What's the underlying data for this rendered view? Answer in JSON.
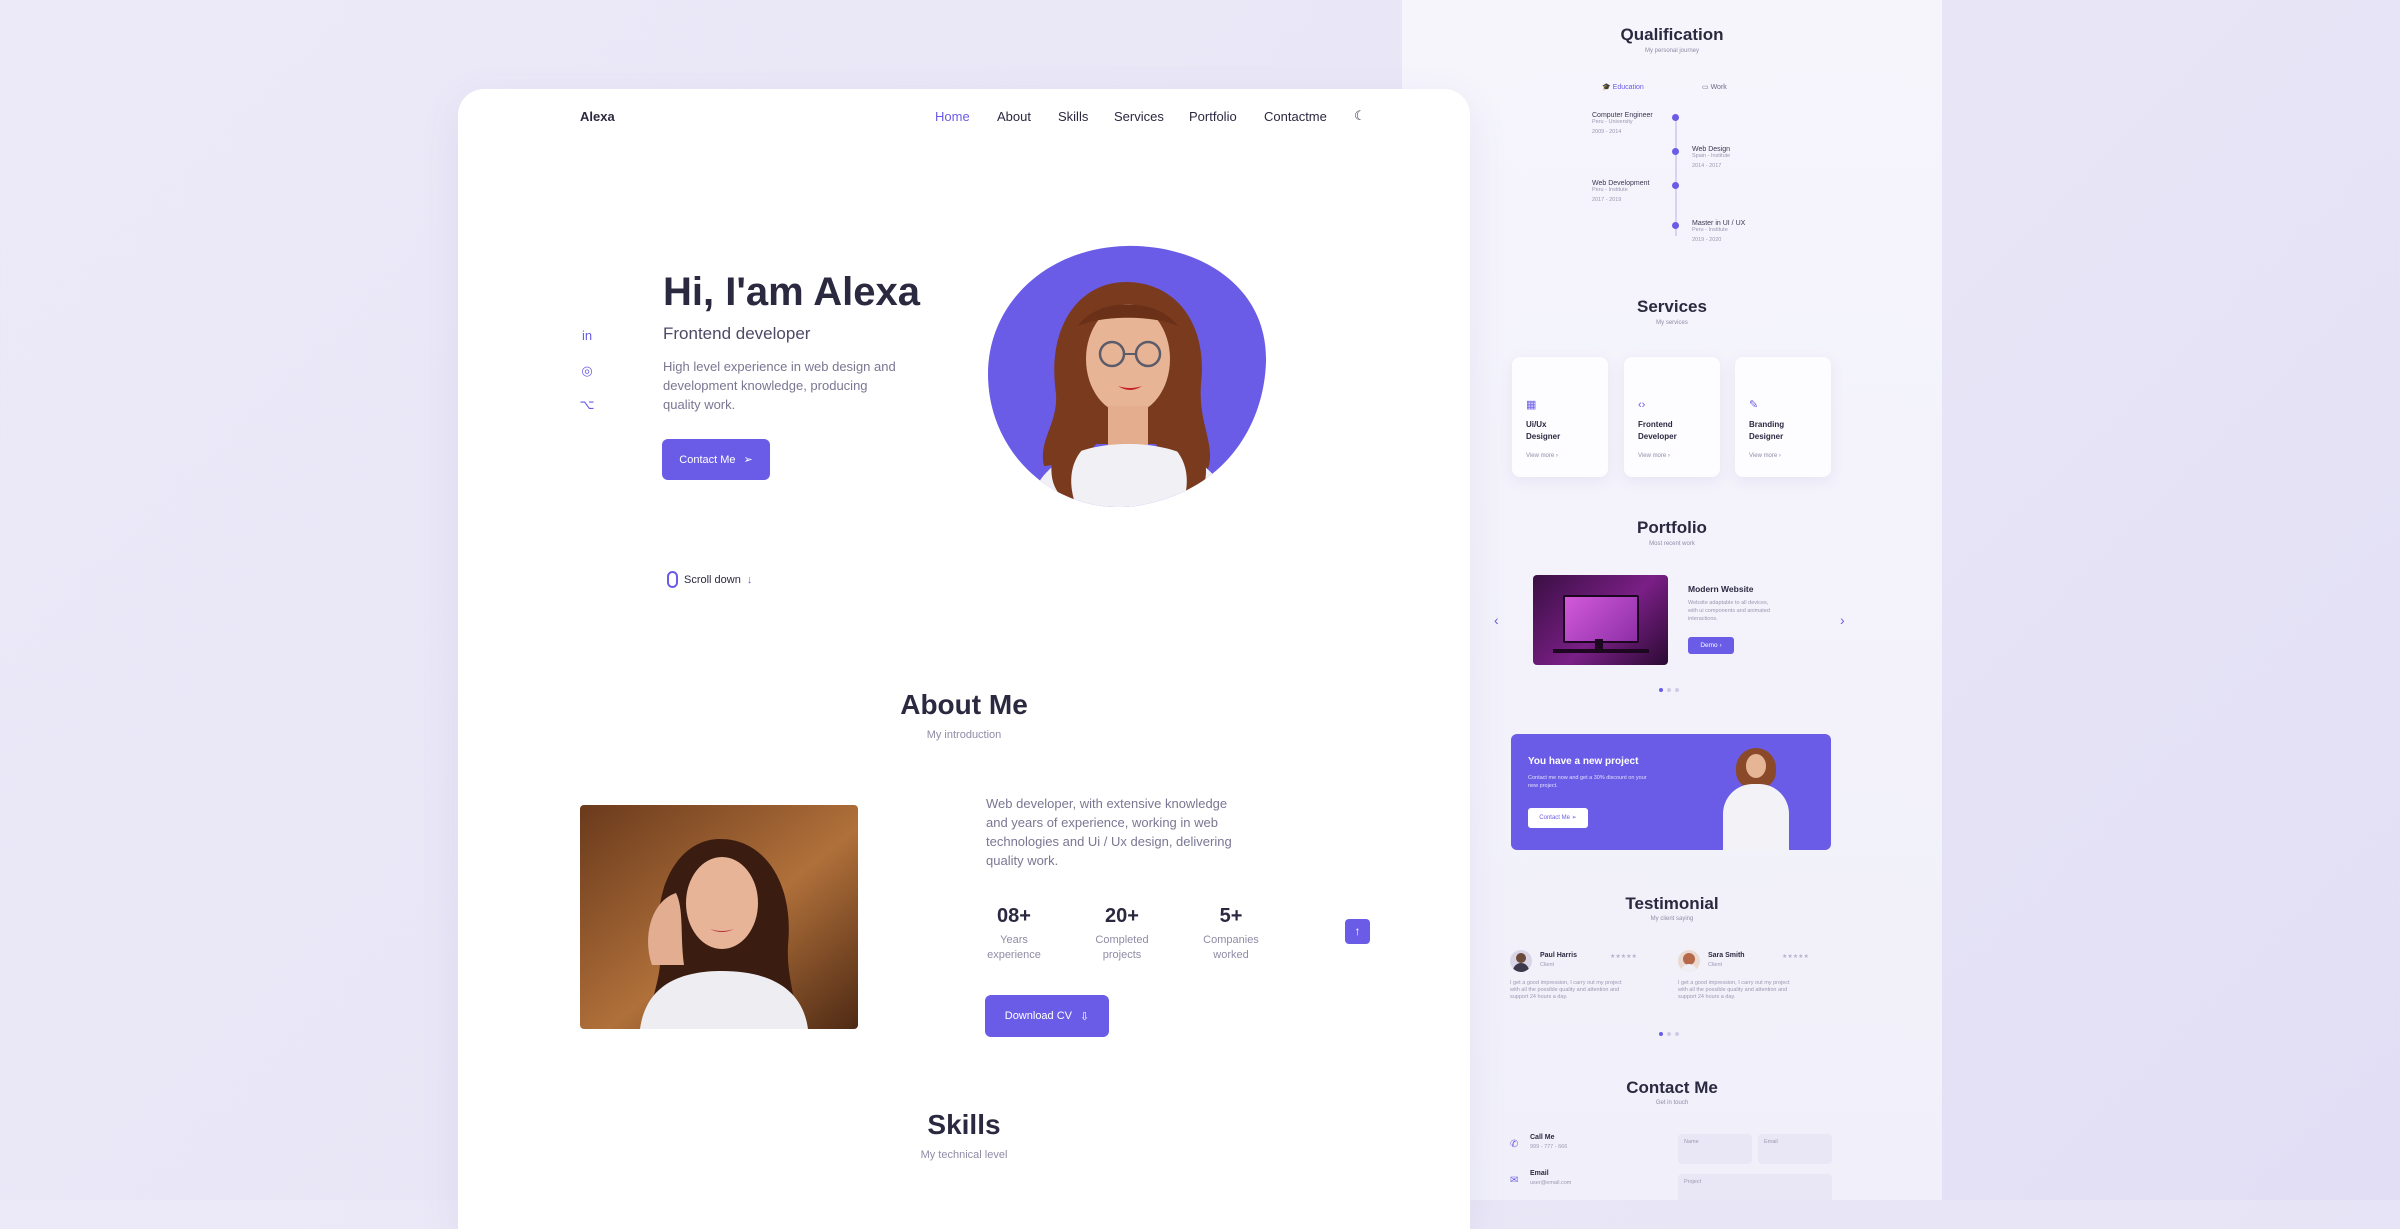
{
  "main": {
    "logo": "Alexa",
    "nav": [
      "Home",
      "About",
      "Skills",
      "Services",
      "Portfolio",
      "Contactme"
    ],
    "hero": {
      "title": "Hi, I'am Alexa",
      "subtitle": "Frontend developer",
      "description_lines": [
        "High level experience in web design and",
        "development knowledge, producing",
        "quality work."
      ],
      "cta": "Contact Me",
      "scroll": "Scroll down"
    },
    "about": {
      "title": "About Me",
      "subtitle": "My introduction",
      "description_lines": [
        "Web developer, with extensive knowledge",
        "and years of experience, working in web",
        "technologies and Ui / Ux design, delivering",
        "quality work."
      ],
      "stats": [
        {
          "value": "08+",
          "label_lines": [
            "Years",
            "experience"
          ]
        },
        {
          "value": "20+",
          "label_lines": [
            "Completed",
            "projects"
          ]
        },
        {
          "value": "5+",
          "label_lines": [
            "Companies",
            "worked"
          ]
        }
      ],
      "download": "Download CV"
    },
    "skills": {
      "title": "Skills",
      "subtitle": "My technical level"
    }
  },
  "right": {
    "qualification": {
      "title": "Qualification",
      "subtitle": "My personal journey",
      "tabs": [
        "Education",
        "Work"
      ],
      "items": [
        {
          "title": "Computer Engineer",
          "place": "Peru - University",
          "date": "2009 - 2014"
        },
        {
          "title": "Web Design",
          "place": "Spain - Institute",
          "date": "2014 - 2017"
        },
        {
          "title": "Web Development",
          "place": "Peru - Institute",
          "date": "2017 - 2019"
        },
        {
          "title": "Master in UI / UX",
          "place": "Peru - Institute",
          "date": "2019 - 2020"
        }
      ]
    },
    "services": {
      "title": "Services",
      "subtitle": "My services",
      "cards": [
        {
          "title_lines": [
            "Ui/Ux",
            "Designer"
          ],
          "link": "View more"
        },
        {
          "title_lines": [
            "Frontend",
            "Developer"
          ],
          "link": "View more"
        },
        {
          "title_lines": [
            "Branding",
            "Designer"
          ],
          "link": "View more"
        }
      ]
    },
    "portfolio": {
      "title": "Portfolio",
      "subtitle": "Most recent work",
      "item_title": "Modern Website",
      "item_desc_lines": [
        "Website adaptable to all devices,",
        "with ui components and animated",
        "interactions."
      ],
      "demo": "Demo"
    },
    "project": {
      "title": "You have a new project",
      "desc_lines": [
        "Contact me now and get a 30% discount on your",
        "new project."
      ],
      "button": "Contact Me"
    },
    "testimonial": {
      "title": "Testimonial",
      "subtitle": "My client saying",
      "clients": [
        {
          "name": "Paul Harris",
          "role": "Client",
          "stars": "★★★★★",
          "text_lines": [
            "I get a good impression, I carry out my project",
            "with all the possible quality and attention and",
            "support 24 hours a day."
          ]
        },
        {
          "name": "Sara Smith",
          "role": "Client",
          "stars": "★★★★★",
          "text_lines": [
            "I get a good impression, I carry out my project",
            "with all the possible quality and attention and",
            "support 24 hours a day."
          ]
        }
      ]
    },
    "contact": {
      "title": "Contact Me",
      "subtitle": "Get in touch",
      "items": [
        {
          "label": "Call Me",
          "value": "999 - 777 - 666"
        },
        {
          "label": "Email",
          "value": "user@email.com"
        }
      ],
      "fields": [
        "Name",
        "Email",
        "Project"
      ]
    }
  },
  "colors": {
    "accent": "#6b5ce7",
    "background": "#eceaf8",
    "text": "#2b2940"
  }
}
